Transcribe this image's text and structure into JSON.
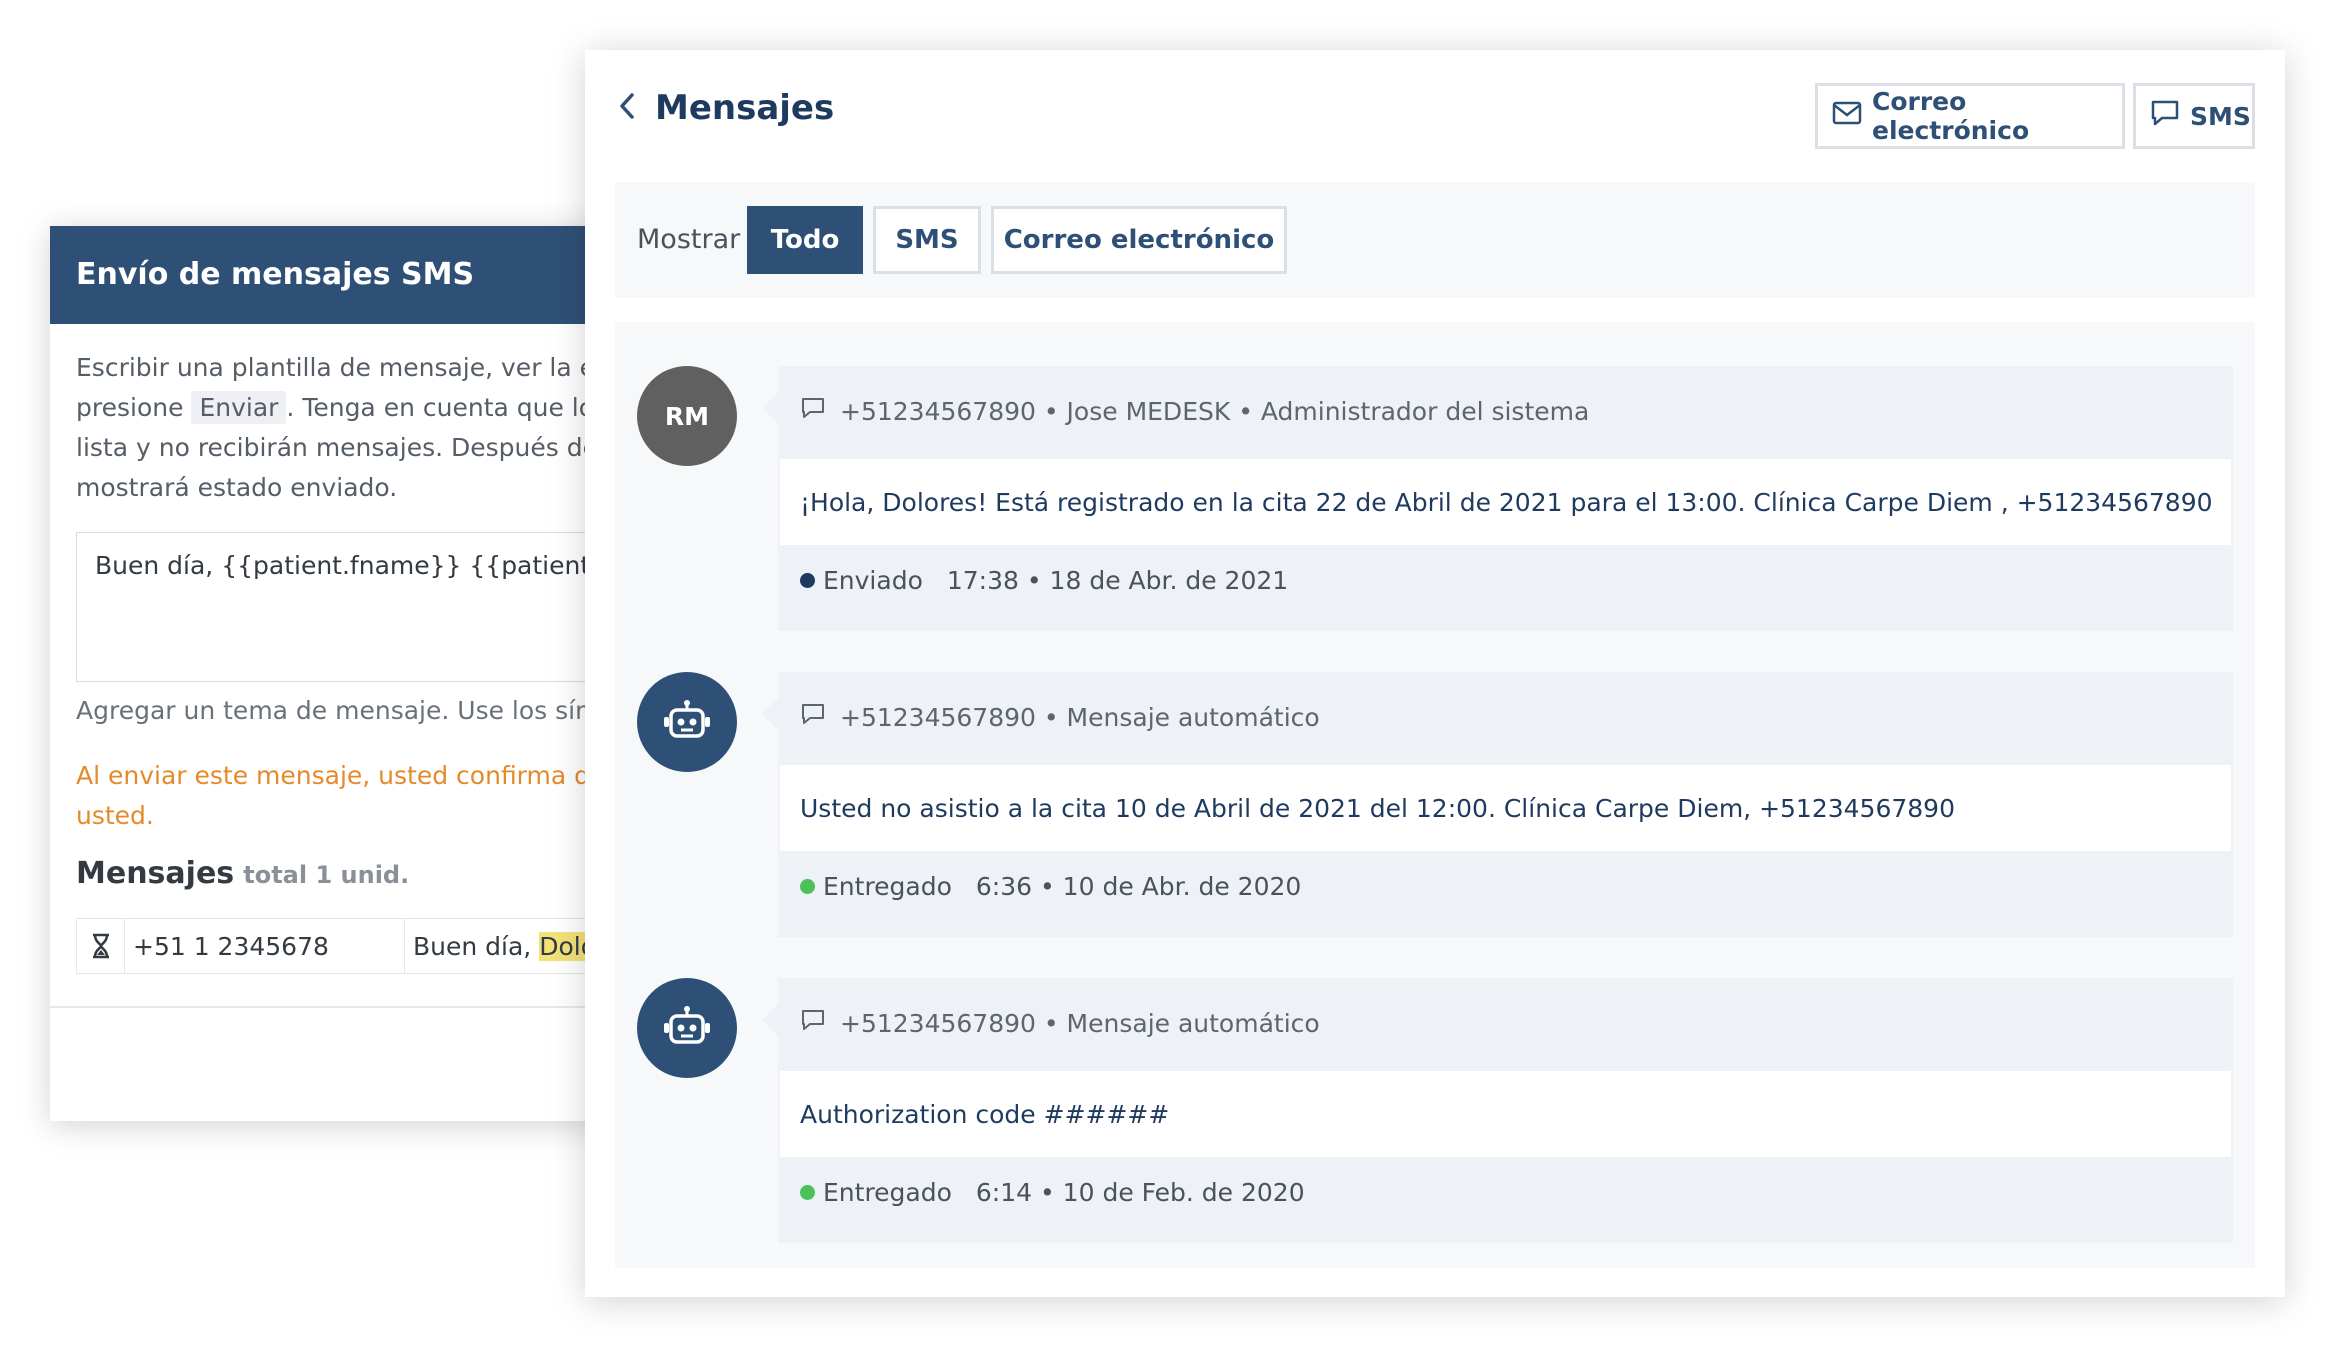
{
  "sms_panel": {
    "title": "Envío de mensajes SMS",
    "description_pre": "Escribir una plantilla de mensaje, ver la ex",
    "description_line2_pre": "presione",
    "send_key": "Enviar",
    "description_line2_post": ". Tenga en cuenta que los",
    "description_line3": "lista y no recibirán mensajes. Después de",
    "description_line4": "mostrará estado enviado.",
    "template_text": "Buen día, {{patient.fname}} {{patient.lna",
    "topic_hint": "Agregar un tema de mensaje. Use los sím",
    "warning_line1": "Al enviar este mensaje, usted confirma qu",
    "warning_line2": "usted.",
    "messages_heading": "Mensajes",
    "messages_count": "total 1 unid.",
    "message_row": {
      "phone": "+51 1 2345678",
      "text_prefix": "Buen día,",
      "text_highlight": "Dolo"
    }
  },
  "messages_panel": {
    "title": "Mensajes",
    "email_button": "Correo electrónico",
    "sms_button": "SMS",
    "filter_label": "Mostrar",
    "filters": [
      "Todo",
      "SMS",
      "Correo electrónico"
    ],
    "active_filter": "Todo",
    "items": [
      {
        "avatar_initials": "RM",
        "meta": "+51234567890 • Jose MEDESK • Administrador del sistema",
        "body": "¡Hola, Dolores! Está registrado en la cita 22 de Abril de 2021 para el 13:00. Clínica Carpe Diem , +51234567890",
        "status": "Enviado",
        "status_color": "#1f3a5f",
        "time": "17:38 • 18 de Abr. de 2021"
      },
      {
        "avatar_icon": "robot-icon",
        "meta": "+51234567890 • Mensaje automático",
        "body": "Usted no asistio a la cita 10 de Abril de 2021 del 12:00. Clínica Carpe Diem, +51234567890",
        "status": "Entregado",
        "status_color": "#4cc15a",
        "time": "6:36 • 10 de Abr. de 2020"
      },
      {
        "avatar_icon": "robot-icon",
        "meta": "+51234567890 • Mensaje automático",
        "body": "Authorization code ######",
        "status": "Entregado",
        "status_color": "#4cc15a",
        "time": "6:14 • 10 de Feb. de 2020"
      }
    ]
  },
  "colors": {
    "primary": "#2f5076",
    "warning": "#e58a2b",
    "delivered": "#4cc15a",
    "highlight": "#f3e27a"
  }
}
